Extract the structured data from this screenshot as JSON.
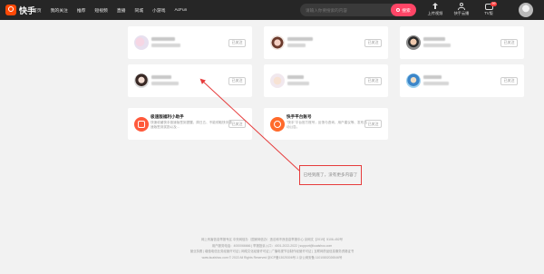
{
  "logo": {
    "text": "快手"
  },
  "nav": {
    "items": [
      "首页",
      "我的关注",
      "推荐",
      "短视频",
      "直播",
      "同城",
      "小游戏",
      "AcFun"
    ]
  },
  "search": {
    "placeholder": "请输入你要搜索的内容",
    "button_label": "搜索"
  },
  "top_actions": {
    "upload": "上传视频",
    "creator": "快手云播",
    "tv": "TV版",
    "tv_badge": "99"
  },
  "cards": [
    {
      "follow_label": "已关注"
    },
    {
      "follow_label": "已关注"
    },
    {
      "follow_label": "已关注"
    },
    {
      "follow_label": "已关注"
    },
    {
      "follow_label": "已关注"
    },
    {
      "follow_label": "已关注"
    },
    {
      "title": "极速版福利小助手",
      "desc": "快速收藏快手极速版签到提醒，周日五、不能领取快手极速版签到奖励以及...",
      "follow_label": "已关注"
    },
    {
      "title": "快手平台账号",
      "desc": "\"快手\"平台官方账号，反馈与咨询、用户建议等、发布活动公告。",
      "follow_label": "已关注"
    }
  ],
  "end_message": "已经到底了，没有更多内容了",
  "footer": {
    "lines": [
      "网上有害信息举报专区      中央网信办（国家网信办）违法和不良信息举报中心      京网文【2019】5106-452号",
      "用户服务电话：4000066666  |  举报投诉入口：4001-2022-2022  |  support@kuaishou.com",
      "营业执照  |  增值电信业务经营许可证  |  网络文化经营许可证  |  广播电视节目制作经营许可证  |  互联网药品信息服务资格证书",
      "www.kuaishou.com © 2022 All Rights Reserved 京ICP备13025306号-1  京公网安备 11010802026546号"
    ]
  },
  "colors": {
    "accent": "#ff4566",
    "topbar": "#262626",
    "annotation": "#e63c3c"
  }
}
